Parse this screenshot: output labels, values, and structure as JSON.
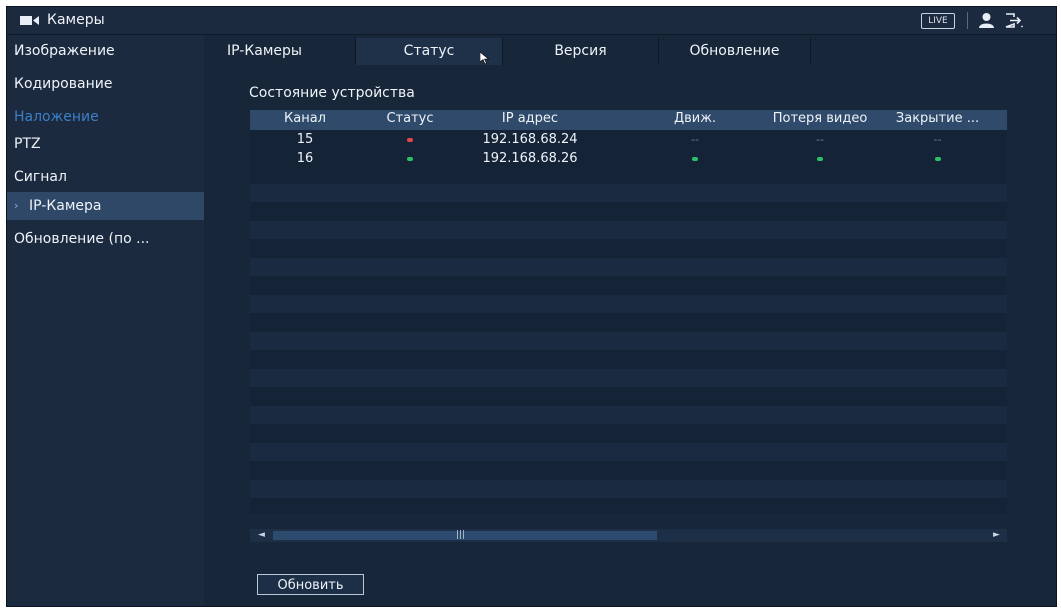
{
  "header": {
    "title": "Камеры",
    "live_label": "LIVE",
    "icons": [
      "camera-icon",
      "user-icon",
      "logout-icon"
    ]
  },
  "sidebar": {
    "items": [
      {
        "label": "Изображение",
        "state": "normal"
      },
      {
        "label": "Кодирование",
        "state": "normal"
      },
      {
        "label": "Наложение",
        "state": "dim"
      },
      {
        "label": "PTZ",
        "state": "normal"
      },
      {
        "label": "Сигнал",
        "state": "normal"
      },
      {
        "label": "IP-Камера",
        "state": "active"
      },
      {
        "label": "Обновление (по ...",
        "state": "normal"
      }
    ],
    "active_chevron": "›"
  },
  "tabs": [
    {
      "label": "IP-Камеры",
      "selected": false
    },
    {
      "label": "Статус",
      "selected": true
    },
    {
      "label": "Версия",
      "selected": false
    },
    {
      "label": "Обновление",
      "selected": false
    }
  ],
  "main": {
    "section_title": "Состояние устройства",
    "columns": [
      "Канал",
      "Статус",
      "IP адрес",
      "Движ.",
      "Потеря видео",
      "Закрытие ..."
    ],
    "rows": [
      {
        "channel": "15",
        "status": "red",
        "ip": "192.168.68.24",
        "motion": "--",
        "video_loss": "--",
        "tampering": "--"
      },
      {
        "channel": "16",
        "status": "green",
        "ip": "192.168.68.26",
        "motion": "green",
        "video_loss": "green",
        "tampering": "green"
      }
    ],
    "refresh_label": "Обновить"
  },
  "colors": {
    "status_red": "#e0474c",
    "status_green": "#2cc06a",
    "accent_dim": "#3d7fc7",
    "background": "#17263a"
  }
}
